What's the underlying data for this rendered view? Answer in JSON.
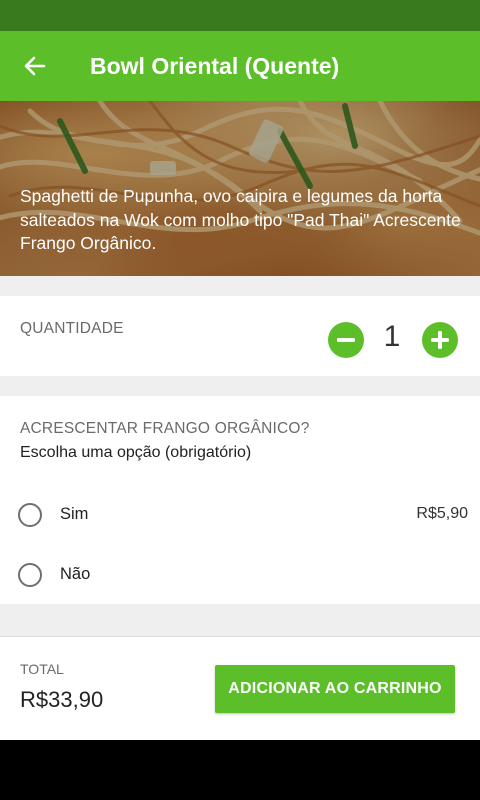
{
  "header": {
    "title": "Bowl Oriental (Quente)",
    "back_icon": "arrow-back-icon"
  },
  "product": {
    "description": "Spaghetti de Pupunha, ovo caipira e legumes da horta salteados na Wok com molho tipo \"Pad Thai\" Acrescente Frango Orgânico."
  },
  "quantity": {
    "label": "QUANTIDADE",
    "value": "1",
    "minus_icon": "minus-circle-icon",
    "plus_icon": "plus-circle-icon"
  },
  "option_group": {
    "title": "ACRESCENTAR FRANGO ORGÂNICO?",
    "subtitle": "Escolha uma opção (obrigatório)",
    "options": [
      {
        "label": "Sim",
        "price": "R$5,90",
        "selected": false
      },
      {
        "label": "Não",
        "price": "",
        "selected": false
      }
    ]
  },
  "footer": {
    "total_label": "TOTAL",
    "total_value": "R$33,90",
    "add_button_label": "ADICIONAR AO CARRINHO"
  },
  "colors": {
    "status_bar": "#3a7a1f",
    "primary": "#5cbf2a",
    "background": "#efefef"
  }
}
